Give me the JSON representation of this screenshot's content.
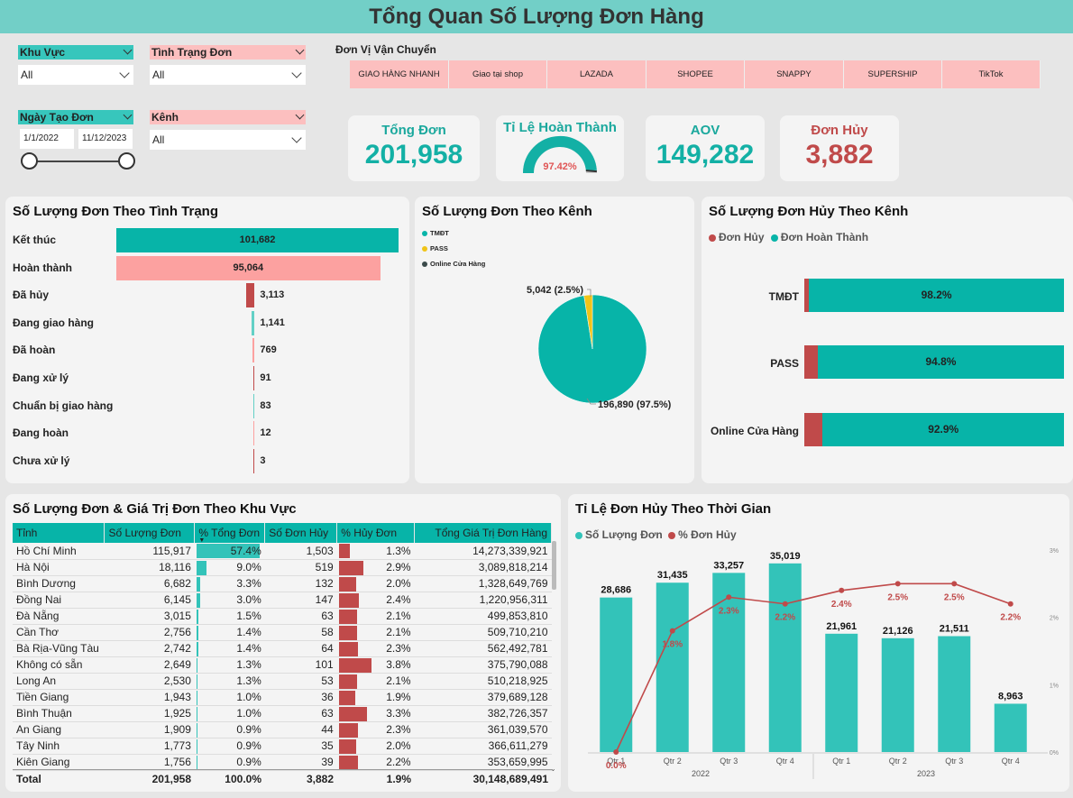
{
  "title": "Tổng Quan Số Lượng Đơn Hàng",
  "filters": {
    "region": {
      "label": "Khu Vực",
      "value": "All"
    },
    "status": {
      "label": "Tình Trạng Đơn",
      "value": "All"
    },
    "date": {
      "label": "Ngày Tạo Đơn",
      "start": "1/1/2022",
      "end": "11/12/2023"
    },
    "channel": {
      "label": "Kênh",
      "value": "All"
    }
  },
  "carriers": {
    "label": "Đơn Vị Vận Chuyển",
    "items": [
      "GIAO HÀNG NHANH",
      "Giao tại shop",
      "LAZADA",
      "SHOPEE",
      "SNAPPY",
      "SUPERSHIP",
      "TikTok"
    ]
  },
  "kpis": {
    "total": {
      "label": "Tổng Đơn",
      "value": "201,958"
    },
    "completion": {
      "label": "Tỉ Lệ Hoàn Thành",
      "value": "97.42%",
      "fraction": 0.9742
    },
    "aov": {
      "label": "AOV",
      "value": "149,282"
    },
    "cancel": {
      "label": "Đơn Hủy",
      "value": "3,882"
    }
  },
  "status_chart": {
    "title": "Số Lượng Đơn Theo Tình Trạng",
    "items": [
      {
        "label": "Kết thúc",
        "value": 101682,
        "display": "101,682",
        "color": "#07b4a8"
      },
      {
        "label": "Hoàn thành",
        "value": 95064,
        "display": "95,064",
        "color": "#fca1a0"
      },
      {
        "label": "Đã hủy",
        "value": 3113,
        "display": "3,113",
        "color": "#c04a4a"
      },
      {
        "label": "Đang giao hàng",
        "value": 1141,
        "display": "1,141",
        "color": "#63d0c6"
      },
      {
        "label": "Đã hoàn",
        "value": 769,
        "display": "769",
        "color": "#fca1a0"
      },
      {
        "label": "Đang xử lý",
        "value": 91,
        "display": "91",
        "color": "#c04a4a"
      },
      {
        "label": "Chuẩn bị giao hàng",
        "value": 83,
        "display": "83",
        "color": "#63d0c6"
      },
      {
        "label": "Đang hoàn",
        "value": 12,
        "display": "12",
        "color": "#fca1a0"
      },
      {
        "label": "Chưa xử lý",
        "value": 3,
        "display": "3",
        "color": "#c04a4a"
      }
    ]
  },
  "channel_pie": {
    "title": "Số Lượng Đơn Theo Kênh",
    "legend": [
      {
        "name": "TMĐT",
        "color": "#07b4a8"
      },
      {
        "name": "PASS",
        "color": "#f0c419"
      },
      {
        "name": "Online Cửa Hàng",
        "color": "#3a4a4a"
      }
    ],
    "slices": [
      {
        "name": "TMĐT",
        "value": 196890,
        "label": "196,890 (97.5%)",
        "color": "#07b4a8"
      },
      {
        "name": "PASS",
        "value": 5042,
        "label": "5,042 (2.5%)",
        "color": "#f0c419"
      }
    ]
  },
  "cancel_channel": {
    "title": "Số Lượng Đơn Hủy Theo Kênh",
    "legend": [
      {
        "name": "Đơn Hủy",
        "color": "#c04a4a"
      },
      {
        "name": "Đơn Hoàn Thành",
        "color": "#07b4a8"
      }
    ],
    "rows": [
      {
        "channel": "TMĐT",
        "complete_pct": 98.2,
        "label": "98.2%"
      },
      {
        "channel": "PASS",
        "complete_pct": 94.8,
        "label": "94.8%"
      },
      {
        "channel": "Online Cửa Hàng",
        "complete_pct": 92.9,
        "label": "92.9%"
      }
    ]
  },
  "region_table": {
    "title": "Số Lượng Đơn & Giá Trị Đơn Theo Khu Vực",
    "headers": [
      "Tỉnh",
      "Số Lượng Đơn",
      "% Tổng Đơn",
      "Số Đơn Hủy",
      "% Hủy Đơn",
      "Tổng Giá Trị Đơn Hàng"
    ],
    "rows": [
      {
        "province": "Hồ Chí Minh",
        "orders": "115,917",
        "pct_total": 57.4,
        "pct_total_label": "57.4%",
        "cancel": "1,503",
        "pct_cancel": 1.3,
        "pct_cancel_label": "1.3%",
        "value": "14,273,339,921"
      },
      {
        "province": "Hà Nội",
        "orders": "18,116",
        "pct_total": 9.0,
        "pct_total_label": "9.0%",
        "cancel": "519",
        "pct_cancel": 2.9,
        "pct_cancel_label": "2.9%",
        "value": "3,089,818,214"
      },
      {
        "province": "Bình Dương",
        "orders": "6,682",
        "pct_total": 3.3,
        "pct_total_label": "3.3%",
        "cancel": "132",
        "pct_cancel": 2.0,
        "pct_cancel_label": "2.0%",
        "value": "1,328,649,769"
      },
      {
        "province": "Đồng Nai",
        "orders": "6,145",
        "pct_total": 3.0,
        "pct_total_label": "3.0%",
        "cancel": "147",
        "pct_cancel": 2.4,
        "pct_cancel_label": "2.4%",
        "value": "1,220,956,311"
      },
      {
        "province": "Đà Nẵng",
        "orders": "3,015",
        "pct_total": 1.5,
        "pct_total_label": "1.5%",
        "cancel": "63",
        "pct_cancel": 2.1,
        "pct_cancel_label": "2.1%",
        "value": "499,853,810"
      },
      {
        "province": "Cần Thơ",
        "orders": "2,756",
        "pct_total": 1.4,
        "pct_total_label": "1.4%",
        "cancel": "58",
        "pct_cancel": 2.1,
        "pct_cancel_label": "2.1%",
        "value": "509,710,210"
      },
      {
        "province": "Bà Rịa-Vũng Tàu",
        "orders": "2,742",
        "pct_total": 1.4,
        "pct_total_label": "1.4%",
        "cancel": "64",
        "pct_cancel": 2.3,
        "pct_cancel_label": "2.3%",
        "value": "562,492,781"
      },
      {
        "province": "Không có sẵn",
        "orders": "2,649",
        "pct_total": 1.3,
        "pct_total_label": "1.3%",
        "cancel": "101",
        "pct_cancel": 3.8,
        "pct_cancel_label": "3.8%",
        "value": "375,790,088"
      },
      {
        "province": "Long An",
        "orders": "2,530",
        "pct_total": 1.3,
        "pct_total_label": "1.3%",
        "cancel": "53",
        "pct_cancel": 2.1,
        "pct_cancel_label": "2.1%",
        "value": "510,218,925"
      },
      {
        "province": "Tiền Giang",
        "orders": "1,943",
        "pct_total": 1.0,
        "pct_total_label": "1.0%",
        "cancel": "36",
        "pct_cancel": 1.9,
        "pct_cancel_label": "1.9%",
        "value": "379,689,128"
      },
      {
        "province": "Bình Thuận",
        "orders": "1,925",
        "pct_total": 1.0,
        "pct_total_label": "1.0%",
        "cancel": "63",
        "pct_cancel": 3.3,
        "pct_cancel_label": "3.3%",
        "value": "382,726,357"
      },
      {
        "province": "An Giang",
        "orders": "1,909",
        "pct_total": 0.9,
        "pct_total_label": "0.9%",
        "cancel": "44",
        "pct_cancel": 2.3,
        "pct_cancel_label": "2.3%",
        "value": "361,039,570"
      },
      {
        "province": "Tây Ninh",
        "orders": "1,773",
        "pct_total": 0.9,
        "pct_total_label": "0.9%",
        "cancel": "35",
        "pct_cancel": 2.0,
        "pct_cancel_label": "2.0%",
        "value": "366,611,279"
      },
      {
        "province": "Kiên Giang",
        "orders": "1,756",
        "pct_total": 0.9,
        "pct_total_label": "0.9%",
        "cancel": "39",
        "pct_cancel": 2.2,
        "pct_cancel_label": "2.2%",
        "value": "353,659,995"
      }
    ],
    "total": {
      "label": "Total",
      "orders": "201,958",
      "pct_total": "100.0%",
      "cancel": "3,882",
      "pct_cancel": "1.9%",
      "value": "30,148,689,491"
    }
  },
  "chart_data": {
    "type": "bar",
    "title": "Tỉ Lệ Đơn Hủy Theo Thời Gian",
    "legend": [
      {
        "name": "Số Lượng Đơn",
        "color": "#33c3b9"
      },
      {
        "name": "% Đơn Hủy",
        "color": "#c04a4a"
      }
    ],
    "categories": [
      "Qtr 1",
      "Qtr 2",
      "Qtr 3",
      "Qtr 4",
      "Qtr 1",
      "Qtr 2",
      "Qtr 3",
      "Qtr 4"
    ],
    "groups": [
      {
        "label": "2022"
      },
      {
        "label": "2023"
      }
    ],
    "series": [
      {
        "name": "Số Lượng Đơn",
        "values": [
          28686,
          31435,
          33257,
          35019,
          21961,
          21126,
          21511,
          8963
        ],
        "labels": [
          "28,686",
          "31,435",
          "33,257",
          "35,019",
          "21,961",
          "21,126",
          "21,511",
          "8,963"
        ]
      },
      {
        "name": "% Đơn Hủy",
        "values": [
          0.0,
          1.8,
          2.3,
          2.2,
          2.4,
          2.5,
          2.5,
          2.2
        ],
        "labels": [
          "0.0%",
          "1.8%",
          "2.3%",
          "2.2%",
          "2.4%",
          "2.5%",
          "2.5%",
          "2.2%"
        ]
      }
    ],
    "y2_ticks": [
      "3%",
      "2%",
      "1%",
      "0%"
    ],
    "y2lim": [
      0,
      3
    ],
    "ylim": [
      0,
      37500
    ]
  }
}
